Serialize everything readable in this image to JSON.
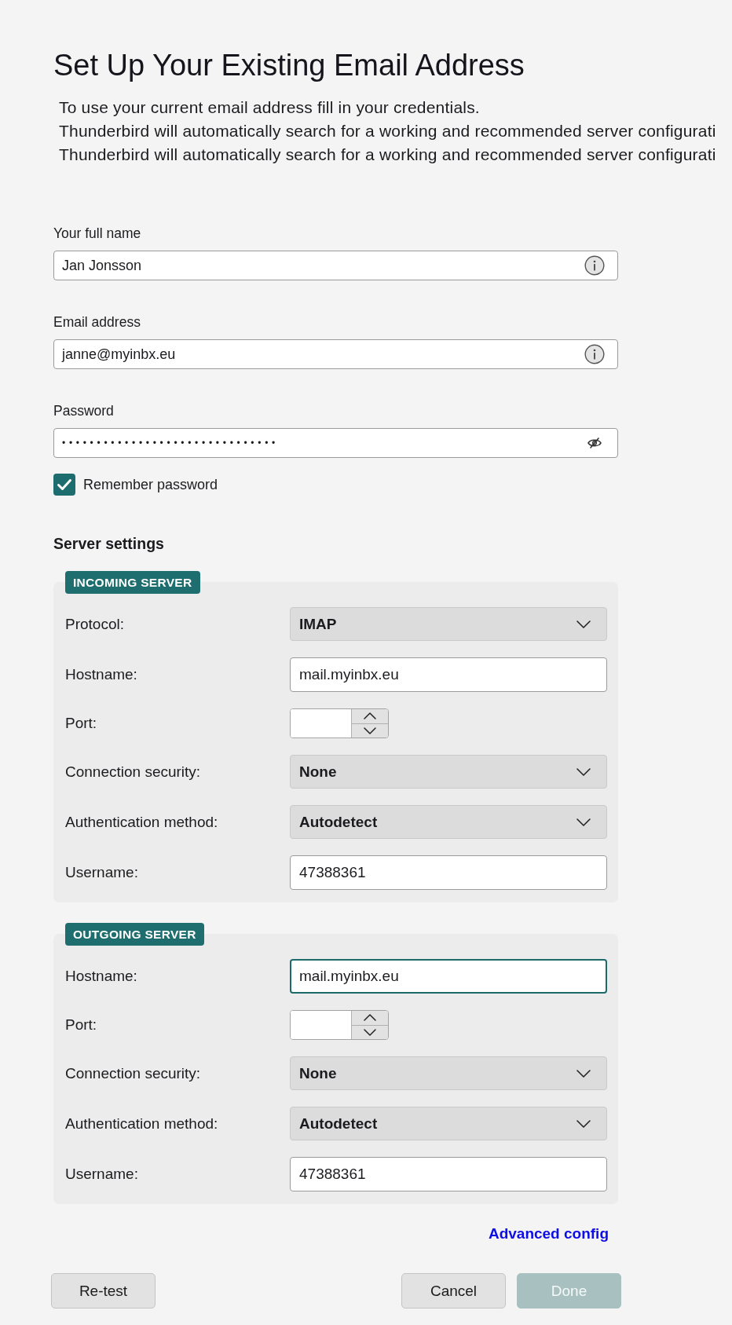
{
  "title": "Set Up Your Existing Email Address",
  "description": [
    "To use your current email address fill in your credentials.",
    "Thunderbird will automatically search for a working and recommended server configurati",
    "Thunderbird will automatically search for a working and recommended server configurati"
  ],
  "fields": [
    {
      "label": "Your full name",
      "kind": "text",
      "value": "Jan Jonsson"
    },
    {
      "label": "Email address",
      "kind": "text",
      "value": "janne@myinbx.eu"
    },
    {
      "label": "Password",
      "kind": "password",
      "value": "•••••••••••••••••••••••••••••••"
    }
  ],
  "remember_password": {
    "label": "Remember password",
    "checked": true
  },
  "server_settings": {
    "heading": "Server settings",
    "sections": [
      {
        "badge": "INCOMING SERVER",
        "rows": [
          {
            "label": "Protocol:",
            "kind": "select",
            "value": "IMAP"
          },
          {
            "label": "Hostname:",
            "kind": "input",
            "value": "mail.myinbx.eu",
            "focused": false
          },
          {
            "label": "Port:",
            "kind": "spinner"
          },
          {
            "label": "Connection security:",
            "kind": "select",
            "value": "None"
          },
          {
            "label": "Authentication method:",
            "kind": "select",
            "value": "Autodetect"
          },
          {
            "label": "Username:",
            "kind": "input",
            "value": "47388361",
            "focused": false
          }
        ]
      },
      {
        "badge": "OUTGOING SERVER",
        "rows": [
          {
            "label": "Hostname:",
            "kind": "input",
            "value": "mail.myinbx.eu",
            "focused": true
          },
          {
            "label": "Port:",
            "kind": "spinner"
          },
          {
            "label": "Connection security:",
            "kind": "select",
            "value": "None"
          },
          {
            "label": "Authentication method:",
            "kind": "select",
            "value": "Autodetect"
          },
          {
            "label": "Username:",
            "kind": "input",
            "value": "47388361",
            "focused": false
          }
        ]
      }
    ]
  },
  "advanced_link": "Advanced config",
  "buttons": {
    "left": [
      {
        "label": "Re-test",
        "disabled": false
      }
    ],
    "right": [
      {
        "label": "Cancel",
        "disabled": false
      },
      {
        "label": "Done",
        "disabled": true
      }
    ]
  }
}
